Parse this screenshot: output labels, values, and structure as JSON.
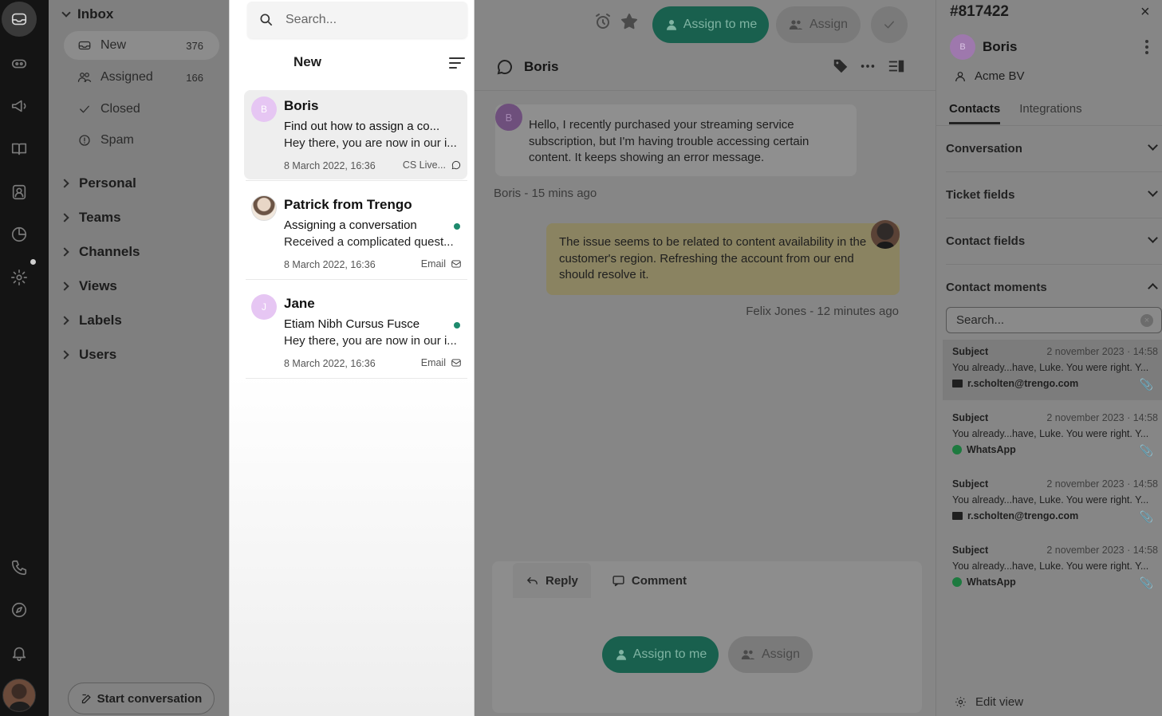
{
  "rail": {
    "icons": [
      "inbox-icon",
      "bot-icon",
      "megaphone-icon",
      "book-icon",
      "contacts-icon",
      "reports-icon",
      "settings-icon",
      "phone-icon",
      "compass-icon",
      "bell-icon",
      "avatar"
    ]
  },
  "nav": {
    "inbox_label": "Inbox",
    "items": [
      {
        "label": "New",
        "count": "376",
        "icon": "inbox-tray-icon"
      },
      {
        "label": "Assigned",
        "count": "166",
        "icon": "users-icon"
      },
      {
        "label": "Closed",
        "count": "",
        "icon": "check-icon"
      },
      {
        "label": "Spam",
        "count": "",
        "icon": "alert-icon"
      }
    ],
    "groups": [
      "Personal",
      "Teams",
      "Channels",
      "Views",
      "Labels",
      "Users"
    ],
    "start_label": "Start conversation"
  },
  "list": {
    "search_placeholder": "Search...",
    "title": "New",
    "cards": [
      {
        "initial": "B",
        "name": "Boris",
        "line1": "Find out how to assign a co...",
        "line2": "Hey there, you are now in our i...",
        "date": "8 March 2022, 16:36",
        "channel": "CS Live..."
      },
      {
        "initial": "",
        "name": "Patrick from Trengo",
        "line1": "Assigning a conversation",
        "line2": "Received a complicated quest...",
        "date": "8 March 2022, 16:36",
        "channel": "Email"
      },
      {
        "initial": "J",
        "name": "Jane",
        "line1": "Etiam Nibh Cursus Fusce",
        "line2": "Hey there, you are now in our i...",
        "date": "8 March 2022, 16:36",
        "channel": "Email"
      }
    ]
  },
  "main": {
    "assign_to_me": "Assign to me",
    "assign": "Assign",
    "contact_name": "Boris",
    "incoming": {
      "initial": "B",
      "text": "Hello, I recently purchased your streaming service subscription, but I'm having trouble accessing certain content. It keeps showing an error message.",
      "meta": "Boris - 15 mins ago"
    },
    "outgoing": {
      "text": "The issue seems to be related to content availability in the customer's region. Refreshing the account from our end should resolve it.",
      "meta": "Felix Jones - 12 minutes ago"
    },
    "composer": {
      "reply": "Reply",
      "comment": "Comment",
      "assign_to_me": "Assign to me",
      "assign": "Assign"
    }
  },
  "side": {
    "ticket_id": "#817422",
    "close": "×",
    "contact_initial": "B",
    "contact_name": "Boris",
    "company": "Acme BV",
    "tabs": [
      "Contacts",
      "Integrations"
    ],
    "sections": [
      "Conversation",
      "Ticket fields",
      "Contact fields",
      "Contact moments"
    ],
    "moments_search_placeholder": "Search...",
    "moments": [
      {
        "subject": "Subject",
        "date": "2 november 2023 · 14:58",
        "text": "You already...have, Luke. You were right. Y...",
        "channel": "r.scholten@trengo.com",
        "channel_type": "mail"
      },
      {
        "subject": "Subject",
        "date": "2 november 2023 · 14:58",
        "text": "You already...have, Luke. You were right. Y...",
        "channel": "WhatsApp",
        "channel_type": "whatsapp"
      },
      {
        "subject": "Subject",
        "date": "2 november 2023 · 14:58",
        "text": "You already...have, Luke. You were right. Y...",
        "channel": "r.scholten@trengo.com",
        "channel_type": "mail"
      },
      {
        "subject": "Subject",
        "date": "2 november 2023 · 14:58",
        "text": "You already...have, Luke. You were right. Y...",
        "channel": "WhatsApp",
        "channel_type": "whatsapp"
      }
    ],
    "edit_view": "Edit view"
  },
  "colors": {
    "brand_green": "#19604e",
    "status_green": "#1e8a6d",
    "avatar_purple": "#e6c6f3"
  }
}
